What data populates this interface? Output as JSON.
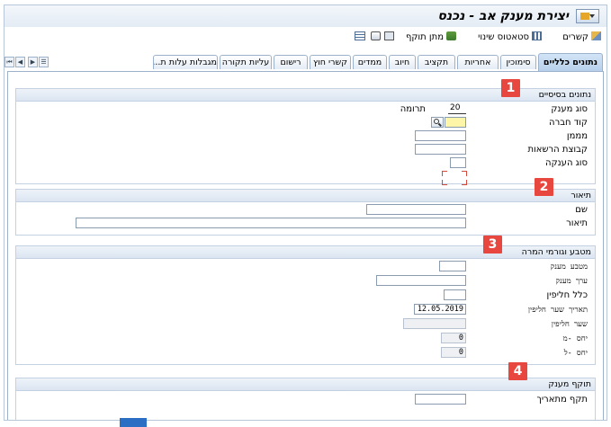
{
  "window": {
    "title": "יצירת מענק אב - נכנס",
    "menu_icon": "sap-menu-icon"
  },
  "toolbar": {
    "items": [
      {
        "label": "",
        "icon": "overview-icon"
      },
      {
        "label": "",
        "icon": "save-icon"
      },
      {
        "label": "מתן תוקף",
        "icon": "validate-icon"
      },
      {
        "label": "סטאטוס שינוי",
        "icon": "status-change-icon"
      },
      {
        "label": "קשרים",
        "icon": "relations-icon"
      }
    ]
  },
  "tabs": [
    {
      "label": "נתונים כלליים",
      "active": true
    },
    {
      "label": "סימוכין"
    },
    {
      "label": "אחריות"
    },
    {
      "label": "תקציב"
    },
    {
      "label": "חיוב"
    },
    {
      "label": "ממדים"
    },
    {
      "label": "קשרי חוץ"
    },
    {
      "label": "רישום"
    },
    {
      "label": "עליות תקורה"
    },
    {
      "label": "מגבלות עלות ת..."
    }
  ],
  "sections": {
    "basic": {
      "title": "נתונים בסיסיים",
      "grant_type_label": "סוג מענק",
      "grant_type_value": "20",
      "grant_type_desc": "תרומה",
      "company_code_label": "קוד חברה",
      "company_code_value": "",
      "sponsor_label": "מממן",
      "sponsor_value": "",
      "authority_group_label": "קבוצת הרשאות",
      "authority_group_value": "",
      "award_type_label": "סוג הענקה",
      "award_type_value": ""
    },
    "description": {
      "title": "תיאור",
      "name_label": "שם",
      "name_value": "",
      "desc_label": "תיאור",
      "desc_value": ""
    },
    "currency": {
      "title": "מטבע וגורמי המרה",
      "grant_currency_label": "מטבע מענק",
      "grant_currency_value": "",
      "grant_value_label": "ערך מענק",
      "grant_value_value": "",
      "exchange_rule_label": "כלל חליפין",
      "exchange_rule_value": "",
      "rate_date_label": "תאריך שער חליפין",
      "rate_date_value": "12.05.2019",
      "rate_label": "שער חליפין",
      "rate_value": "",
      "ratio_from_label": "יחס -מ",
      "ratio_from_value": "0",
      "ratio_to_label": "יחס -ל",
      "ratio_to_value": "0"
    },
    "validity": {
      "title": "תוקף מענק",
      "valid_from_label": "תקף מתאריך",
      "valid_from_value": ""
    }
  },
  "annotations": [
    "1",
    "2",
    "3",
    "4"
  ],
  "colors": {
    "badge": "#e8473f",
    "required_field": "#fff5a8",
    "active_tab": "#b7d0eb"
  }
}
